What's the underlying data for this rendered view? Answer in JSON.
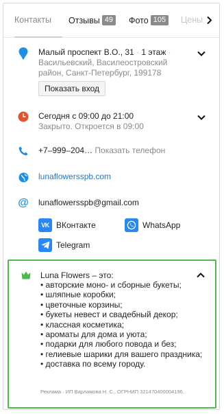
{
  "tabs": [
    {
      "label": "Контакты"
    },
    {
      "label": "Отзывы",
      "badge": "49"
    },
    {
      "label": "Фото",
      "badge": "105"
    },
    {
      "label": "Цены"
    }
  ],
  "address": {
    "line1": "Малый проспект В.О., 31",
    "floor": "1 этаж",
    "line2": "Васильевский, Василеостровский район, Санкт-Петербург, 199178",
    "show_entry": "Показать вход"
  },
  "hours": {
    "today": "Сегодня с 09:00 до 21:00",
    "status": "Закрыто. Откроется в 09:00"
  },
  "phone": {
    "number": "+7–999–204…",
    "show": "Показать телефон"
  },
  "website": "lunaflowersspb.com",
  "email": "lunaflowersspb@gmail.com",
  "socials": {
    "vk": "ВКонтакте",
    "whatsapp": "WhatsApp",
    "telegram": "Telegram"
  },
  "ad": {
    "title": "Luna Flowers – это:",
    "items": [
      "• авторские моно- и сборные букеты;",
      "• шляпные коробки;",
      "• цветочные корзины;",
      "• букеты невест и свадебный декор;",
      "• классная косметика;",
      "• ароматы для дома и уюта;",
      "• подарки для любого повода и без;",
      "• гелиевые шарики для вашего праздника;",
      "• доставка по всему городу."
    ],
    "footer": "Реклама · ИП Варламова Н. С., ОГРНИП 321470400004196."
  },
  "colors": {
    "accent_green": "#4cbb4c",
    "link_blue": "#2b74c9",
    "map_pin": "#1f8fe6",
    "clock_red": "#e5532d"
  }
}
